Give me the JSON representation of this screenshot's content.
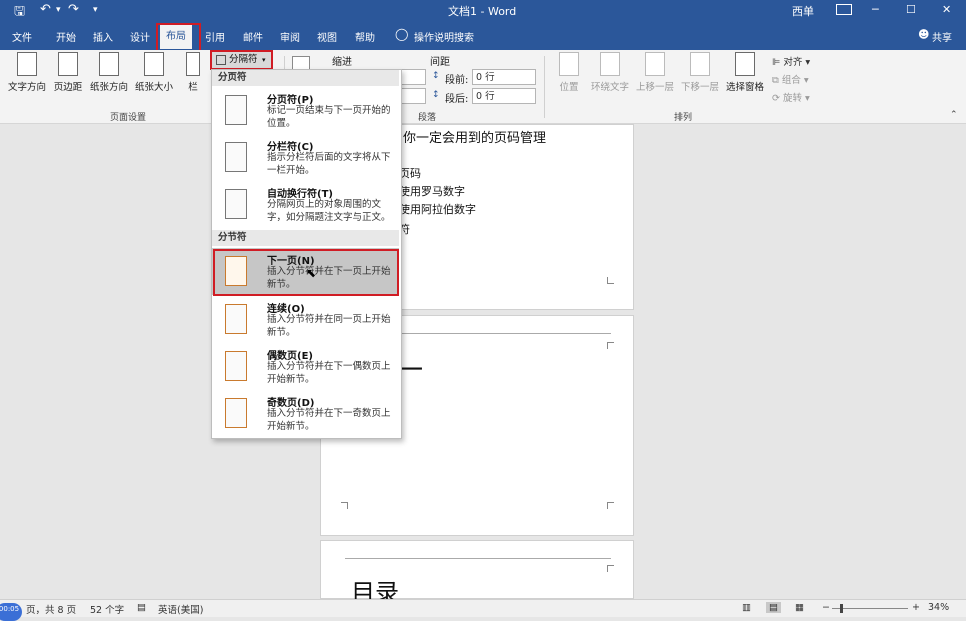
{
  "titlebar": {
    "doc_title": "文档1 - Word",
    "user": "西单",
    "minimize": "─",
    "restore": "☐",
    "close": "✕",
    "save_glyph": "🖫",
    "undo_glyph": "↶",
    "redo_glyph": "↷",
    "more_glyph": "▾"
  },
  "tabs": {
    "file": "文件",
    "home": "开始",
    "insert": "插入",
    "design": "设计",
    "layout": "布局",
    "references": "引用",
    "mailings": "邮件",
    "review": "审阅",
    "view": "视图",
    "help": "帮助",
    "tellme": "操作说明搜索",
    "share": "共享"
  },
  "ribbon": {
    "text_direction": "文字方向",
    "margins": "页边距",
    "orientation": "纸张方向",
    "size": "纸张大小",
    "columns": "栏",
    "breaks": "分隔符",
    "page_setup_group": "页面设置",
    "indent": "缩进",
    "spacing": "间距",
    "space_before_label": "段前:",
    "space_before_value": "0 行",
    "space_after_label": "段后:",
    "space_after_value": "0 行",
    "paragraph_group": "段落",
    "position": "位置",
    "wrap_text": "环绕文字",
    "bring_forward": "上移一层",
    "send_backward": "下移一层",
    "selection_pane": "选择窗格",
    "align": "对齐",
    "group": "组合",
    "rotate": "旋转",
    "arrange_group": "排列"
  },
  "dropdown": {
    "page_breaks_header": "分页符",
    "section_breaks_header": "分节符",
    "items": [
      {
        "title": "分页符(P)",
        "desc": "标记一页结束与下一页开始的位置。"
      },
      {
        "title": "分栏符(C)",
        "desc": "指示分栏符后面的文字将从下一栏开始。"
      },
      {
        "title": "自动换行符(T)",
        "desc": "分隔网页上的对象周围的文字，如分隔题注文字与正文。"
      },
      {
        "title": "下一页(N)",
        "desc": "插入分节符并在下一页上开始新节。"
      },
      {
        "title": "连续(O)",
        "desc": "插入分节符并在同一页上开始新节。"
      },
      {
        "title": "偶数页(E)",
        "desc": "插入分节符并在下一偶数页上开始新节。"
      },
      {
        "title": "奇数页(D)",
        "desc": "插入分节符并在下一奇数页上开始新节。"
      }
    ]
  },
  "document": {
    "heading": "你一定会用到的页码管理",
    "line1": "页码",
    "line2": "使用罗马数字",
    "line3": "使用阿拉伯数字",
    "line4": "符",
    "page2_char": "一",
    "page3_title": "目录"
  },
  "statusbar": {
    "page_info": "页，共 8 页",
    "word_count": "52 个字",
    "language": "英语(美国)",
    "zoom_minus": "−",
    "zoom_plus": "+",
    "zoom": "34%",
    "timer": "00:05"
  }
}
